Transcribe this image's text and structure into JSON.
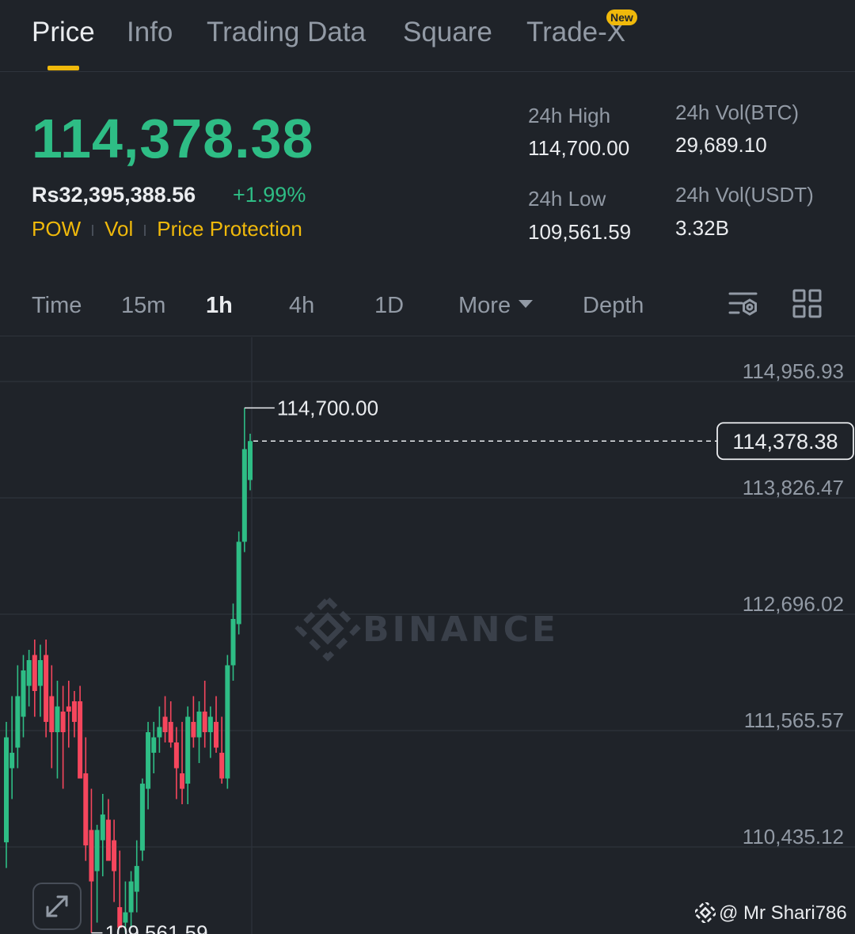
{
  "tabs": [
    {
      "label": "Price",
      "active": true
    },
    {
      "label": "Info",
      "active": false
    },
    {
      "label": "Trading Data",
      "active": false
    },
    {
      "label": "Square",
      "active": false
    },
    {
      "label": "Trade-X",
      "active": false,
      "badge": "New"
    }
  ],
  "header": {
    "price": "114,378.38",
    "fiat_price": "Rs32,395,388.56",
    "change": "+1.99%",
    "tags": [
      "POW",
      "Vol",
      "Price Protection"
    ]
  },
  "stats": {
    "high_label": "24h High",
    "high_value": "114,700.00",
    "low_label": "24h Low",
    "low_value": "109,561.59",
    "vol_btc_label": "24h Vol(BTC)",
    "vol_btc_value": "29,689.10",
    "vol_usdt_label": "24h Vol(USDT)",
    "vol_usdt_value": "3.32B"
  },
  "intervals": {
    "items": [
      {
        "label": "Time",
        "active": false
      },
      {
        "label": "15m",
        "active": false
      },
      {
        "label": "1h",
        "active": true
      },
      {
        "label": "4h",
        "active": false
      },
      {
        "label": "1D",
        "active": false
      }
    ],
    "more_label": "More",
    "depth_label": "Depth",
    "icons": [
      "chart-settings-icon",
      "grid-layout-icon"
    ]
  },
  "chart_data": {
    "type": "candlestick",
    "y_ticks": [
      "114,956.93",
      "113,826.47",
      "112,696.02",
      "111,565.57",
      "110,435.12"
    ],
    "current_price_label": "114,378.38",
    "high_annotation": "114,700.00",
    "low_annotation": "109,561.59",
    "watermark": "BINANCE",
    "colors": {
      "up": "#2ebd85",
      "down": "#f6465d",
      "grid": "#2b3139",
      "text": "#929aa5"
    },
    "candles": [
      {
        "o": 110480,
        "h": 111650,
        "l": 110230,
        "c": 111500
      },
      {
        "o": 111200,
        "h": 111900,
        "l": 110900,
        "c": 111350
      },
      {
        "o": 111400,
        "h": 112200,
        "l": 111200,
        "c": 111900
      },
      {
        "o": 111700,
        "h": 112300,
        "l": 111500,
        "c": 112150
      },
      {
        "o": 112000,
        "h": 112350,
        "l": 111800,
        "c": 112250
      },
      {
        "o": 112300,
        "h": 112450,
        "l": 111700,
        "c": 111950
      },
      {
        "o": 112000,
        "h": 112400,
        "l": 111700,
        "c": 112250
      },
      {
        "o": 112300,
        "h": 112450,
        "l": 111500,
        "c": 111650
      },
      {
        "o": 111900,
        "h": 112200,
        "l": 111200,
        "c": 111550
      },
      {
        "o": 111550,
        "h": 112050,
        "l": 111100,
        "c": 111800
      },
      {
        "o": 111750,
        "h": 112000,
        "l": 111000,
        "c": 111550
      },
      {
        "o": 111800,
        "h": 112050,
        "l": 111400,
        "c": 111750
      },
      {
        "o": 111850,
        "h": 111950,
        "l": 111500,
        "c": 111650
      },
      {
        "o": 111850,
        "h": 112000,
        "l": 111250,
        "c": 111100
      },
      {
        "o": 111150,
        "h": 111500,
        "l": 110300,
        "c": 110450
      },
      {
        "o": 110600,
        "h": 111000,
        "l": 109600,
        "c": 110100
      },
      {
        "o": 110200,
        "h": 110650,
        "l": 109700,
        "c": 110600
      },
      {
        "o": 110500,
        "h": 110950,
        "l": 110150,
        "c": 110750
      },
      {
        "o": 110700,
        "h": 110900,
        "l": 110350,
        "c": 110300
      },
      {
        "o": 110500,
        "h": 110700,
        "l": 109900,
        "c": 110200
      },
      {
        "o": 109850,
        "h": 110400,
        "l": 109700,
        "c": 109650
      },
      {
        "o": 109700,
        "h": 110100,
        "l": 109600,
        "c": 109800
      },
      {
        "o": 109800,
        "h": 110200,
        "l": 109650,
        "c": 110100
      },
      {
        "o": 110000,
        "h": 110500,
        "l": 109800,
        "c": 110250
      },
      {
        "o": 110400,
        "h": 111100,
        "l": 110300,
        "c": 111050
      },
      {
        "o": 111000,
        "h": 111650,
        "l": 110800,
        "c": 111550
      },
      {
        "o": 111350,
        "h": 111650,
        "l": 111150,
        "c": 111500
      },
      {
        "o": 111500,
        "h": 111800,
        "l": 111350,
        "c": 111600
      },
      {
        "o": 111700,
        "h": 111900,
        "l": 111450,
        "c": 111550
      },
      {
        "o": 111650,
        "h": 111850,
        "l": 111400,
        "c": 111450
      },
      {
        "o": 111450,
        "h": 111600,
        "l": 110900,
        "c": 111200
      },
      {
        "o": 111150,
        "h": 111650,
        "l": 110850,
        "c": 111000
      },
      {
        "o": 111050,
        "h": 111800,
        "l": 110850,
        "c": 111700
      },
      {
        "o": 111650,
        "h": 111900,
        "l": 111400,
        "c": 111500
      },
      {
        "o": 111500,
        "h": 111850,
        "l": 111250,
        "c": 111750
      },
      {
        "o": 111750,
        "h": 112050,
        "l": 111400,
        "c": 111550
      },
      {
        "o": 111550,
        "h": 111800,
        "l": 111300,
        "c": 111700
      },
      {
        "o": 111650,
        "h": 111900,
        "l": 111350,
        "c": 111400
      },
      {
        "o": 111350,
        "h": 111700,
        "l": 111050,
        "c": 111100
      },
      {
        "o": 111100,
        "h": 112300,
        "l": 111000,
        "c": 112200
      },
      {
        "o": 112200,
        "h": 112800,
        "l": 112050,
        "c": 112650
      },
      {
        "o": 112600,
        "h": 113500,
        "l": 112500,
        "c": 113400
      },
      {
        "o": 113400,
        "h": 114700,
        "l": 113300,
        "c": 114300
      },
      {
        "o": 114000,
        "h": 114450,
        "l": 113900,
        "c": 114378.38
      }
    ]
  },
  "footer": {
    "credit": "@ Mr Shari786"
  }
}
